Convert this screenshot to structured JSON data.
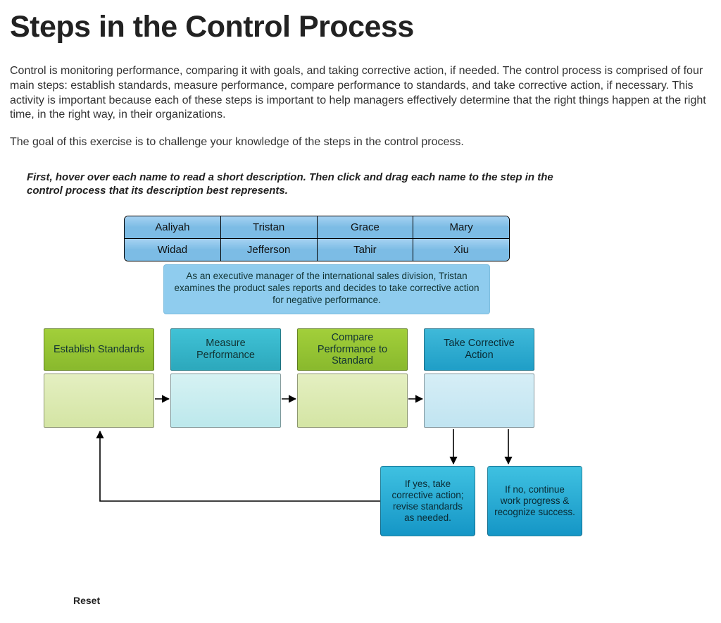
{
  "title": "Steps in the Control Process",
  "paragraph1": "Control is monitoring performance, comparing it with goals, and taking corrective action, if needed. The control process is comprised of four main steps: establish standards, measure performance, compare performance to standards, and take corrective action, if necessary. This activity is important because each of these steps is important to help managers effectively determine that the right things happen at the right time, in the right way, in their organizations.",
  "paragraph2": "The goal of this exercise is to challenge your knowledge of the steps in the control process.",
  "instruction": "First, hover over each name to read a short description. Then click and drag each name to the step in the control process that its description best represents.",
  "chips_row1": [
    "Aaliyah",
    "Tristan",
    "Grace",
    "Mary"
  ],
  "chips_row2": [
    "Widad",
    "Jefferson",
    "Tahir",
    "Xiu"
  ],
  "tooltip": "As an executive manager of the international sales division, Tristan examines the product sales reports and decides to take corrective action for negative performance.",
  "steps": {
    "s1": "Establish Standards",
    "s2": "Measure Performance",
    "s3": "Compare Performance to Standard",
    "s4": "Take Corrective Action"
  },
  "outcomes": {
    "yes": "If yes, take corrective action; revise standards as needed.",
    "no": "If no, continue work progress & recognize success."
  },
  "reset_label": "Reset"
}
